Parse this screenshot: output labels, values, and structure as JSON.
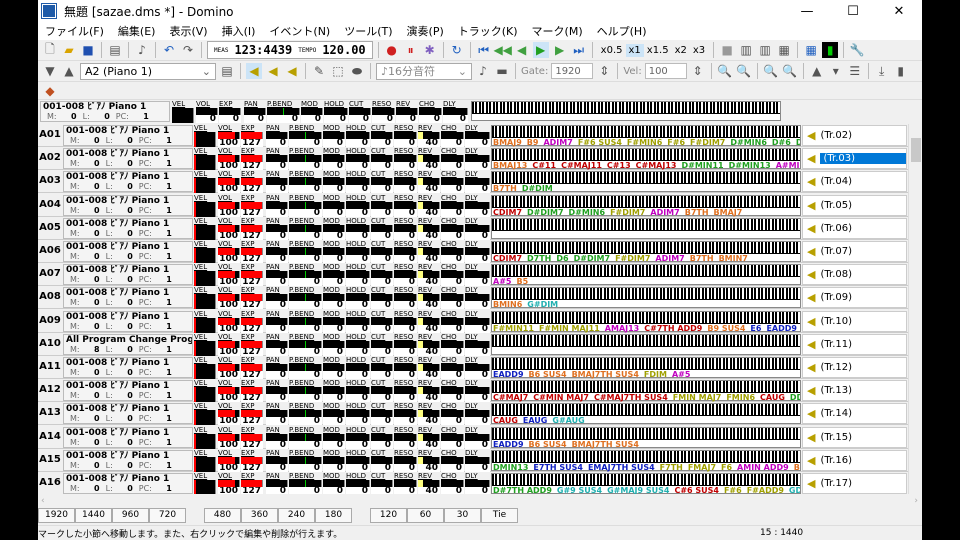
{
  "window": {
    "title": "無題 [sazae.dms *] - Domino",
    "minimize": "—",
    "maximize": "☐",
    "close": "✕"
  },
  "menu": [
    "ファイル(F)",
    "編集(E)",
    "表示(V)",
    "挿入(I)",
    "イベント(N)",
    "ツール(T)",
    "演奏(P)",
    "トラック(K)",
    "マーク(M)",
    "ヘルプ(H)"
  ],
  "toolbar": {
    "meas_label": "MEAS",
    "meas": "123:4439",
    "tempo_label": "TEMPO",
    "tempo": "120.00",
    "speeds": [
      "x0.5",
      "x1",
      "x1.5",
      "x2",
      "x3"
    ],
    "active_speed": 1
  },
  "toolbar2": {
    "track_select": "A2 (Piano 1)",
    "note_length": "16分音符",
    "gate_label": "Gate:",
    "gate": "1920",
    "vel_label": "Vel:",
    "vel": "100"
  },
  "controllers": [
    "VEL",
    "VOL",
    "EXP",
    "PAN",
    "P.BEND",
    "MOD",
    "HOLD",
    "CUT",
    "RESO",
    "REV",
    "CHO",
    "DLY"
  ],
  "header": {
    "name": "001-008 ﾋﾟｱﾉ Piano 1",
    "m": "0",
    "l": "0",
    "pc": "1",
    "values": [
      "",
      "0",
      "0",
      "0",
      "0",
      "0",
      "0",
      "0",
      "0",
      "0",
      "0",
      "0"
    ]
  },
  "labels": {
    "m": "M:",
    "l": "L:",
    "pc": "PC:"
  },
  "chord_colors": {
    "C": "#c00000",
    "D": "#20a020",
    "E": "#1020c0",
    "F": "#a0a000",
    "G": "#20b0b0",
    "A": "#c000c0",
    "B": "#e07020"
  },
  "rows": [
    {
      "id": "A01",
      "name": "001-008 ﾋﾟｱﾉ Piano 1",
      "m": "0",
      "l": "0",
      "pc": "1",
      "track": "(Tr.02)",
      "chords": [
        "BMAJ9",
        "B9",
        "ADIM7",
        "F#6 SUS4",
        "F#MIN6",
        "F#6",
        "F#DIM7",
        "D#MIN6",
        "D#6",
        "D#DIM"
      ]
    },
    {
      "id": "A02",
      "name": "001-008 ﾋﾟｱﾉ Piano 1",
      "m": "0",
      "l": "0",
      "pc": "1",
      "track": "(Tr.03)",
      "selected": true,
      "chords": [
        "BMAJ13",
        "C#11",
        "C#MAJ11",
        "C#13",
        "C#MAJ13",
        "D#MIN11",
        "D#MIN13",
        "A#MIN"
      ]
    },
    {
      "id": "A03",
      "name": "001-008 ﾋﾟｱﾉ Piano 1",
      "m": "0",
      "l": "0",
      "pc": "1",
      "track": "(Tr.04)",
      "chords": [
        "B7TH",
        "D#DIM"
      ]
    },
    {
      "id": "A04",
      "name": "001-008 ﾋﾟｱﾉ Piano 1",
      "m": "0",
      "l": "0",
      "pc": "1",
      "track": "(Tr.05)",
      "chords": [
        "CDIM7",
        "D#DIM7",
        "D#MIN6",
        "F#DIM7",
        "ADIM7",
        "B7TH",
        "BMAJ7"
      ]
    },
    {
      "id": "A05",
      "name": "001-008 ﾋﾟｱﾉ Piano 1",
      "m": "0",
      "l": "0",
      "pc": "1",
      "track": "(Tr.06)",
      "chords": []
    },
    {
      "id": "A06",
      "name": "001-008 ﾋﾟｱﾉ Piano 1",
      "m": "0",
      "l": "0",
      "pc": "1",
      "track": "(Tr.07)",
      "chords": [
        "CDIM7",
        "D7TH",
        "D6",
        "D#DIM7",
        "F#DIM7",
        "ADIM7",
        "B7TH",
        "BMIN7"
      ]
    },
    {
      "id": "A07",
      "name": "001-008 ﾋﾟｱﾉ Piano 1",
      "m": "0",
      "l": "0",
      "pc": "1",
      "track": "(Tr.08)",
      "chords": [
        "A#5",
        "B5"
      ]
    },
    {
      "id": "A08",
      "name": "001-008 ﾋﾟｱﾉ Piano 1",
      "m": "0",
      "l": "0",
      "pc": "1",
      "track": "(Tr.09)",
      "chords": [
        "BMIN6",
        "G#DIM"
      ]
    },
    {
      "id": "A09",
      "name": "001-008 ﾋﾟｱﾉ Piano 1",
      "m": "0",
      "l": "0",
      "pc": "1",
      "track": "(Tr.10)",
      "chords": [
        "F#MIN11",
        "F#MIN MAJ11",
        "AMAJ13",
        "C#7TH ADD9",
        "B9 SUS4",
        "E6",
        "EADD9",
        "E"
      ]
    },
    {
      "id": "A10",
      "name": "All Program Change Program C",
      "m": "8",
      "l": "0",
      "pc": "1",
      "track": "(Tr.11)",
      "chords": []
    },
    {
      "id": "A11",
      "name": "001-008 ﾋﾟｱﾉ Piano 1",
      "m": "0",
      "l": "0",
      "pc": "1",
      "track": "(Tr.12)",
      "chords": [
        "EADD9",
        "B6 SUS4",
        "BMAJ7TH SUS4",
        "FDIM",
        "A#5"
      ]
    },
    {
      "id": "A12",
      "name": "001-008 ﾋﾟｱﾉ Piano 1",
      "m": "0",
      "l": "0",
      "pc": "1",
      "track": "(Tr.13)",
      "chords": [
        "C#MAJ7",
        "C#MIN MAJ7",
        "C#MAJ7TH SUS4",
        "FMIN MAJ7",
        "FMIN6",
        "CAUG",
        "DDIM"
      ]
    },
    {
      "id": "A13",
      "name": "001-008 ﾋﾟｱﾉ Piano 1",
      "m": "0",
      "l": "0",
      "pc": "1",
      "track": "(Tr.14)",
      "chords": [
        "CAUG",
        "EAUG",
        "G#AUG"
      ]
    },
    {
      "id": "A14",
      "name": "001-008 ﾋﾟｱﾉ Piano 1",
      "m": "0",
      "l": "0",
      "pc": "1",
      "track": "(Tr.15)",
      "chords": [
        "EADD9",
        "B6 SUS4",
        "BMAJ7TH SUS4"
      ]
    },
    {
      "id": "A15",
      "name": "001-008 ﾋﾟｱﾉ Piano 1",
      "m": "0",
      "l": "0",
      "pc": "1",
      "track": "(Tr.16)",
      "chords": [
        "DMIN13",
        "E7TH SUS4",
        "EMAJ7TH SUS4",
        "F7TH",
        "FMAJ7",
        "F6",
        "AMIN ADD9",
        "BD"
      ]
    },
    {
      "id": "A16",
      "name": "001-008 ﾋﾟｱﾉ Piano 1",
      "m": "0",
      "l": "0",
      "pc": "1",
      "track": "(Tr.17)",
      "chords": [
        "D#7TH ADD9",
        "G#9 SUS4",
        "G#MAJ9 SUS4",
        "C#6 SUS4",
        "F#6",
        "F#ADD9",
        "GDIM"
      ]
    }
  ],
  "row_values": [
    "",
    "100",
    "127",
    "0",
    "0",
    "0",
    "0",
    "0",
    "0",
    "40",
    "0",
    "0"
  ],
  "row_fills": [
    0,
    0.79,
    1,
    0,
    0,
    0,
    0,
    0,
    0,
    0.31,
    0,
    0
  ],
  "note_buttons": [
    "1920",
    "1440",
    "960",
    "720",
    "480",
    "360",
    "240",
    "180",
    "120",
    "60",
    "30",
    "Tie"
  ],
  "status": {
    "message": "マークした小節へ移動します。また、右クリックで編集や削除が行えます。",
    "position": "15 : 1440"
  }
}
